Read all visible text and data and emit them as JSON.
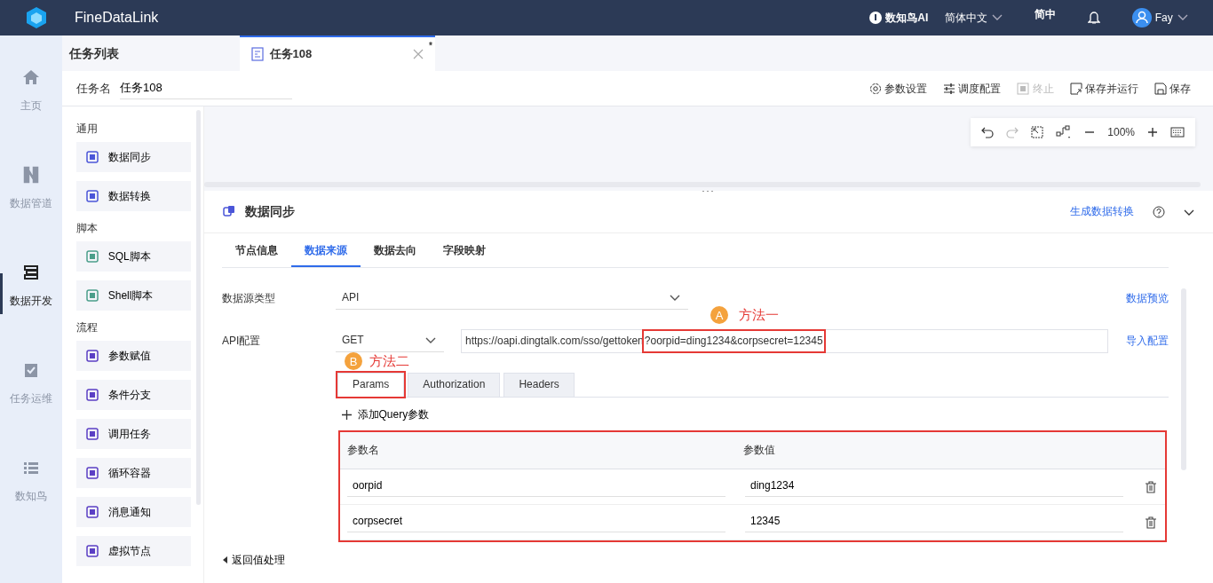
{
  "app": {
    "name": "FineDataLink"
  },
  "header": {
    "ai": "数知鸟AI",
    "language": "简体中文",
    "short_lang": "简中",
    "user": "Fay"
  },
  "rail": [
    {
      "label": "主页",
      "selected": false
    },
    {
      "label": "数据管道",
      "selected": false
    },
    {
      "label": "数据开发",
      "selected": true
    },
    {
      "label": "任务运维",
      "selected": false
    },
    {
      "label": "数知鸟",
      "selected": false
    }
  ],
  "tabs_bar": {
    "list_title": "任务列表",
    "tabs": [
      {
        "label": "任务108",
        "modified_mark": "*",
        "selected": true
      }
    ]
  },
  "task_name": {
    "label": "任务名",
    "value": "任务108"
  },
  "toolbar": [
    {
      "label": "参数设置",
      "disabled": false
    },
    {
      "label": "调度配置",
      "disabled": false
    },
    {
      "label": "终止",
      "disabled": true
    },
    {
      "label": "保存并运行",
      "disabled": false
    },
    {
      "label": "保存",
      "disabled": false
    }
  ],
  "canvas_tools": {
    "zoom": "100%"
  },
  "palette": [
    {
      "title": "通用",
      "items": [
        "数据同步",
        "数据转换"
      ]
    },
    {
      "title": "脚本",
      "items": [
        "SQL脚本",
        "Shell脚本"
      ]
    },
    {
      "title": "流程",
      "items": [
        "参数赋值",
        "条件分支",
        "调用任务",
        "循环容器",
        "消息通知",
        "虚拟节点"
      ]
    }
  ],
  "node_panel": {
    "title": "数据同步",
    "action": "生成数据转换",
    "tabs": [
      {
        "label": "节点信息",
        "selected": false
      },
      {
        "label": "数据来源",
        "selected": true
      },
      {
        "label": "数据去向",
        "selected": false
      },
      {
        "label": "字段映射",
        "selected": false
      }
    ],
    "source_type": {
      "label": "数据源类型",
      "value": "API"
    },
    "preview_link": "数据预览",
    "api": {
      "label": "API配置",
      "method": "GET",
      "url": "https://oapi.dingtalk.com/sso/gettoken",
      "query": "?oorpid=ding1234&corpsecret=12345",
      "import_link": "导入配置"
    },
    "request_tabs": [
      {
        "label": "Params",
        "selected": true
      },
      {
        "label": "Authorization",
        "selected": false
      },
      {
        "label": "Headers",
        "selected": false
      }
    ],
    "add_param": "添加Query参数",
    "columns": [
      "参数名",
      "参数值"
    ],
    "params": [
      {
        "name": "oorpid",
        "value": "ding1234"
      },
      {
        "name": "corpsecret",
        "value": "12345"
      }
    ],
    "return_section": "返回值处理"
  },
  "annotations": [
    {
      "letter": "A",
      "text": "方法一"
    },
    {
      "letter": "B",
      "text": "方法二"
    }
  ]
}
